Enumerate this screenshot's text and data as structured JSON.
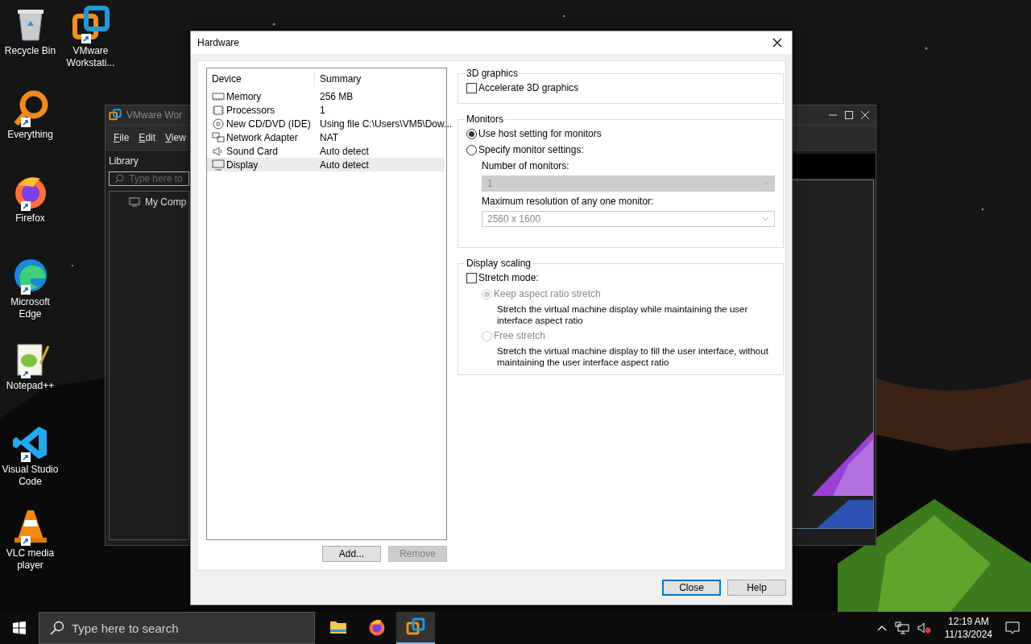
{
  "desktop_icons": [
    {
      "label": "Recycle Bin",
      "kind": "recycle",
      "shortcut": false
    },
    {
      "label": "VMware Workstati...",
      "kind": "vmware",
      "shortcut": true
    },
    {
      "label": "Everything",
      "kind": "everything",
      "shortcut": true
    },
    {
      "label": "Firefox",
      "kind": "firefox",
      "shortcut": true
    },
    {
      "label": "Microsoft Edge",
      "kind": "edge",
      "shortcut": true
    },
    {
      "label": "Notepad++",
      "kind": "notepad",
      "shortcut": true
    },
    {
      "label": "Visual Studio Code",
      "kind": "vscode",
      "shortcut": true
    },
    {
      "label": "VLC media player",
      "kind": "vlc",
      "shortcut": true
    }
  ],
  "background_window": {
    "title": "VMware Wor",
    "menu": [
      "File",
      "Edit",
      "View"
    ],
    "library_label": "Library",
    "search_placeholder": "Type here to",
    "tree_item": "My Comp"
  },
  "dialog": {
    "title": "Hardware",
    "device_table": {
      "columns": [
        "Device",
        "Summary"
      ],
      "rows": [
        {
          "device": "Memory",
          "summary": "256 MB",
          "kind": "memory",
          "selected": false
        },
        {
          "device": "Processors",
          "summary": "1",
          "kind": "processor",
          "selected": false
        },
        {
          "device": "New CD/DVD (IDE)",
          "summary": "Using file C:\\Users\\VM5\\Dow...",
          "kind": "disc",
          "selected": false
        },
        {
          "device": "Network Adapter",
          "summary": "NAT",
          "kind": "network",
          "selected": false
        },
        {
          "device": "Sound Card",
          "summary": "Auto detect",
          "kind": "sound",
          "selected": false
        },
        {
          "device": "Display",
          "summary": "Auto detect",
          "kind": "display",
          "selected": true
        }
      ]
    },
    "add_button": {
      "label": "Add...",
      "disabled": false
    },
    "remove_button": {
      "label": "Remove",
      "disabled": true
    },
    "graphics_group": {
      "title": "3D graphics",
      "accelerate": {
        "label": "Accelerate 3D graphics",
        "checked": false
      }
    },
    "monitors_group": {
      "title": "Monitors",
      "options": [
        {
          "label": "Use host setting for monitors",
          "selected": true
        },
        {
          "label": "Specify monitor settings:",
          "selected": false
        }
      ],
      "number_of_monitors": {
        "label": "Number of monitors:",
        "value": "1",
        "disabled": true
      },
      "max_resolution": {
        "label": "Maximum resolution of any one monitor:",
        "value": "2560 x 1600",
        "disabled": true
      }
    },
    "scaling_group": {
      "title": "Display scaling",
      "stretch_mode": {
        "label": "Stretch mode:",
        "checked": false
      },
      "options": [
        {
          "label": "Keep aspect ratio stretch",
          "description": "Stretch the virtual machine display while maintaining the user interface aspect ratio",
          "selected": true,
          "disabled": true
        },
        {
          "label": "Free stretch",
          "description": "Stretch the virtual machine display to fill the user interface, without maintaining the user interface aspect ratio",
          "selected": false,
          "disabled": true
        }
      ]
    },
    "footer_buttons": [
      {
        "label": "Close",
        "default": true
      },
      {
        "label": "Help",
        "default": false
      }
    ]
  },
  "taskbar": {
    "search_placeholder": "Type here to search",
    "apps": [
      {
        "kind": "explorer",
        "active": false
      },
      {
        "kind": "firefox",
        "active": false
      },
      {
        "kind": "vmware",
        "active": true
      }
    ],
    "time": "12:19 AM",
    "date": "11/13/2024"
  }
}
